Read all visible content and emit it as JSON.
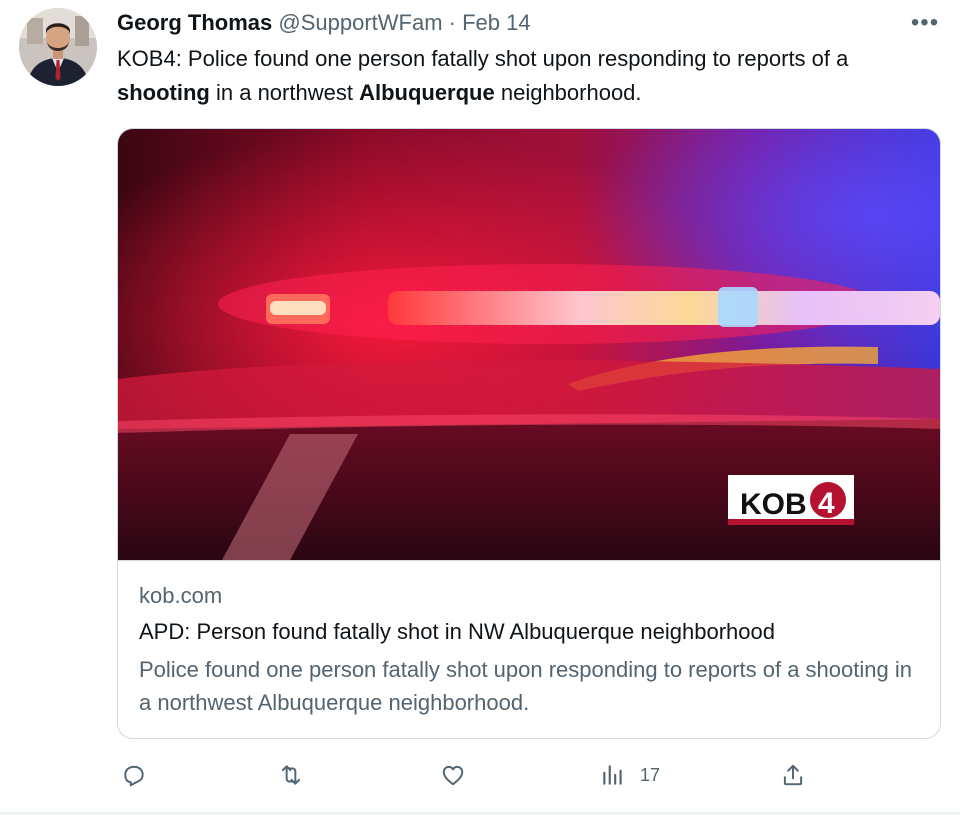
{
  "tweet": {
    "author_name": "Georg Thomas",
    "handle": "@SupportWFam",
    "separator": " · ",
    "date": "Feb 14",
    "more_label": "•••",
    "text_parts": [
      {
        "text": "KOB4: Police found one person fatally shot upon responding to reports of a ",
        "bold": false
      },
      {
        "text": "shooting",
        "bold": true
      },
      {
        "text": " in a northwest ",
        "bold": false
      },
      {
        "text": "Albuquerque",
        "bold": true
      },
      {
        "text": " neighborhood.",
        "bold": false
      }
    ]
  },
  "card": {
    "watermark": "KOB",
    "watermark_digit": "4",
    "domain": "kob.com",
    "title": "APD: Person found fatally shot in NW Albuquerque neighborhood",
    "description": "Police found one person fatally shot upon responding to reports of a shooting in a northwest Albuquerque neighborhood."
  },
  "actions": {
    "reply_icon": "reply-icon",
    "retweet_icon": "retweet-icon",
    "like_icon": "heart-icon",
    "views_icon": "views-icon",
    "views_count": "17",
    "share_icon": "share-icon"
  },
  "colors": {
    "muted": "#536471",
    "border": "#cfd9de",
    "text": "#0f1419"
  }
}
